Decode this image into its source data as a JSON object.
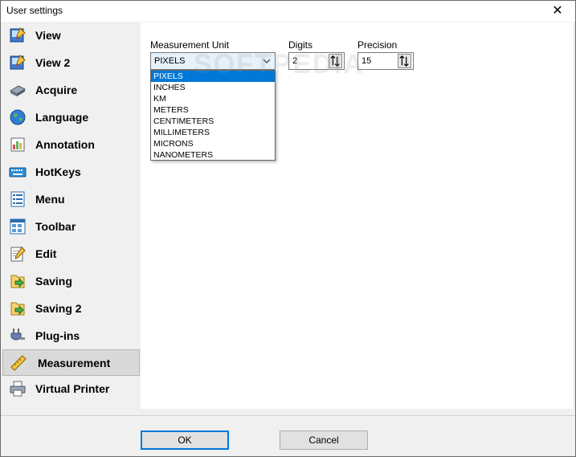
{
  "window": {
    "title": "User settings",
    "close_glyph": "✕"
  },
  "sidebar": {
    "items": [
      {
        "label": "View",
        "icon": "view-icon"
      },
      {
        "label": "View 2",
        "icon": "view2-icon"
      },
      {
        "label": "Acquire",
        "icon": "acquire-icon"
      },
      {
        "label": "Language",
        "icon": "globe-icon"
      },
      {
        "label": "Annotation",
        "icon": "annotation-icon"
      },
      {
        "label": "HotKeys",
        "icon": "keyboard-icon"
      },
      {
        "label": "Menu",
        "icon": "menu-icon"
      },
      {
        "label": "Toolbar",
        "icon": "toolbar-icon"
      },
      {
        "label": "Edit",
        "icon": "edit-icon"
      },
      {
        "label": "Saving",
        "icon": "saving-icon"
      },
      {
        "label": "Saving 2",
        "icon": "saving2-icon"
      },
      {
        "label": "Plug-ins",
        "icon": "plugin-icon"
      },
      {
        "label": "Measurement",
        "icon": "ruler-icon",
        "selected": true
      },
      {
        "label": "Virtual Printer",
        "icon": "printer-icon"
      }
    ]
  },
  "measurement": {
    "unit_label": "Measurement Unit",
    "unit_value": "PIXELS",
    "unit_options": [
      "PIXELS",
      "INCHES",
      "KM",
      "METERS",
      "CENTIMETERS",
      "MILLIMETERS",
      "MICRONS",
      "NANOMETERS"
    ],
    "digits_label": "Digits",
    "digits_value": "2",
    "precision_label": "Precision",
    "precision_value": "15"
  },
  "buttons": {
    "ok": "OK",
    "cancel": "Cancel"
  },
  "watermark": "SOFTPEDIA",
  "colors": {
    "selection": "#0078d7",
    "sidebar_selected": "#d9d9d9"
  }
}
